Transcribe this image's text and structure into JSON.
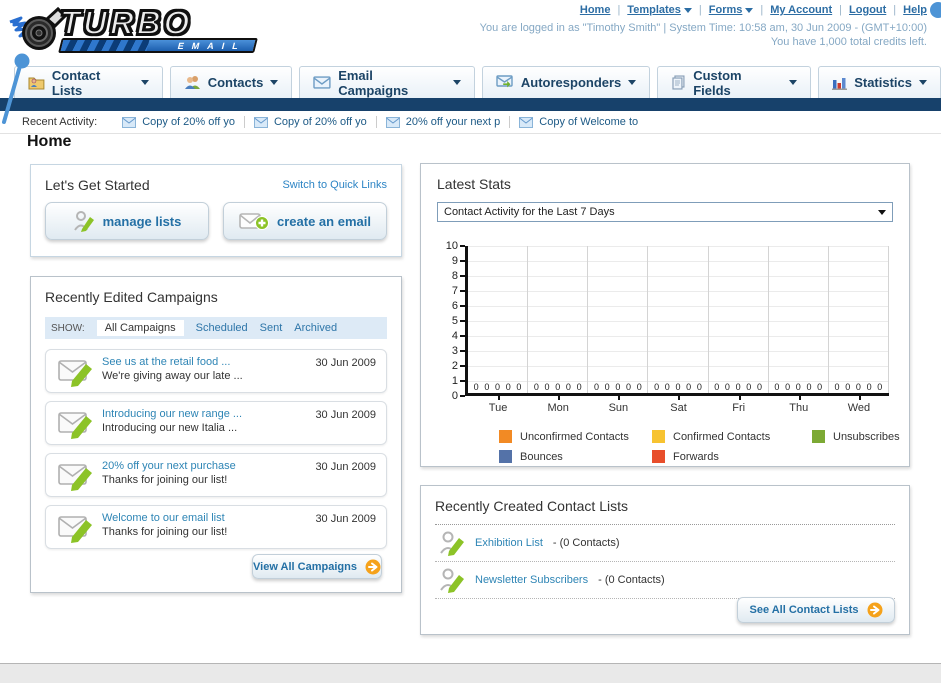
{
  "brand": {
    "top": "TURBO",
    "bottom": "EMAIL"
  },
  "header": {
    "links": [
      {
        "label": "Home",
        "dropdown": false
      },
      {
        "label": "Templates",
        "dropdown": true
      },
      {
        "label": "Forms",
        "dropdown": true
      },
      {
        "label": "My Account",
        "dropdown": false
      },
      {
        "label": "Logout",
        "dropdown": false
      },
      {
        "label": "Help",
        "dropdown": false
      }
    ],
    "status_line1": "You are logged in as \"Timothy Smith\" | System Time: 10:58 am, 30 Jun 2009 - (GMT+10:00)",
    "status_line2": "You have 1,000 total credits left."
  },
  "nav": {
    "tabs": [
      {
        "label": "Contact Lists"
      },
      {
        "label": "Contacts"
      },
      {
        "label": "Email Campaigns"
      },
      {
        "label": "Autoresponders"
      },
      {
        "label": "Custom Fields"
      },
      {
        "label": "Statistics"
      }
    ]
  },
  "activity": {
    "label": "Recent Activity:",
    "items": [
      {
        "label": "Copy of 20% off yo"
      },
      {
        "label": "Copy of 20% off yo"
      },
      {
        "label": "20% off your next p"
      },
      {
        "label": "Copy of Welcome to"
      }
    ]
  },
  "page_title": "Home",
  "get_started": {
    "title": "Let's Get Started",
    "switch_link": "Switch to Quick Links",
    "manage_lists_label": "manage lists",
    "create_email_label": "create an email"
  },
  "campaigns": {
    "title": "Recently Edited Campaigns",
    "show_label": "SHOW:",
    "filters": {
      "all": "All Campaigns",
      "scheduled": "Scheduled",
      "sent": "Sent",
      "archived": "Archived"
    },
    "items": [
      {
        "title": "See us at the retail food ...",
        "subtitle": "We're giving away our late ...",
        "date": "30 Jun 2009"
      },
      {
        "title": "Introducing our new range ...",
        "subtitle": "Introducing our new Italia ...",
        "date": "30 Jun 2009"
      },
      {
        "title": "20% off your next purchase",
        "subtitle": "Thanks for joining our list!",
        "date": "30 Jun 2009"
      },
      {
        "title": "Welcome to our email list",
        "subtitle": "Thanks for joining our list!",
        "date": "30 Jun 2009"
      }
    ],
    "view_all_label": "View All Campaigns"
  },
  "stats": {
    "title": "Latest Stats",
    "selected_report": "Contact Activity for the Last 7 Days"
  },
  "chart_data": {
    "type": "bar",
    "title": "Contact Activity for the Last 7 Days",
    "categories": [
      "Tue",
      "Mon",
      "Sun",
      "Sat",
      "Fri",
      "Thu",
      "Wed"
    ],
    "series": [
      {
        "name": "Unconfirmed Contacts",
        "color": "#F28A24",
        "values": [
          0,
          0,
          0,
          0,
          0,
          0,
          0
        ]
      },
      {
        "name": "Confirmed Contacts",
        "color": "#F7C331",
        "values": [
          0,
          0,
          0,
          0,
          0,
          0,
          0
        ]
      },
      {
        "name": "Unsubscribes",
        "color": "#7CA934",
        "values": [
          0,
          0,
          0,
          0,
          0,
          0,
          0
        ]
      },
      {
        "name": "Bounces",
        "color": "#5472A8",
        "values": [
          0,
          0,
          0,
          0,
          0,
          0,
          0
        ]
      },
      {
        "name": "Forwards",
        "color": "#E84E2B",
        "values": [
          0,
          0,
          0,
          0,
          0,
          0,
          0
        ]
      }
    ],
    "ylim": [
      0,
      10
    ],
    "grid": true,
    "legend_position": "bottom"
  },
  "contact_lists": {
    "title": "Recently Created Contact Lists",
    "items": [
      {
        "name": "Exhibition List",
        "count": "- (0 Contacts)"
      },
      {
        "name": "Newsletter Subscribers",
        "count": "- (0 Contacts)"
      }
    ],
    "see_all_label": "See All Contact Lists"
  },
  "colors": {
    "navy_bar": "#17416b",
    "link_blue": "#2c6da4",
    "callout_blue": "#4d94d6"
  }
}
